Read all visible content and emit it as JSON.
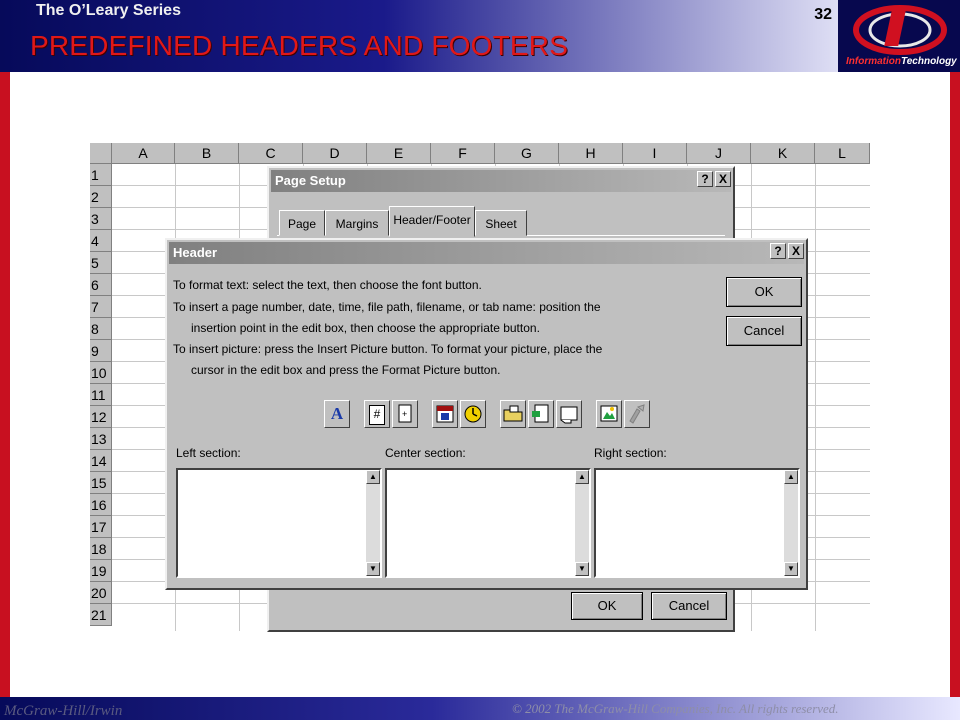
{
  "slide": {
    "series": "The O’Leary Series",
    "title": "PREDEFINED HEADERS AND FOOTERS",
    "page_number": "32",
    "logo_text_a": "Information",
    "logo_text_b": "Technology",
    "publisher": "McGraw-Hill/Irwin",
    "copyright": "© 2002  The McGraw-Hill  Companies, Inc. All rights reserved.",
    "colors": {
      "title": "#e01818",
      "bar": "#060a5a",
      "edge": "#c81020"
    }
  },
  "spreadsheet": {
    "columns": [
      "A",
      "B",
      "C",
      "D",
      "E",
      "F",
      "G",
      "H",
      "I",
      "J",
      "K",
      "L"
    ],
    "rows": [
      "1",
      "2",
      "3",
      "4",
      "5",
      "6",
      "7",
      "8",
      "9",
      "10",
      "11",
      "12",
      "13",
      "14",
      "15",
      "16",
      "17",
      "18",
      "19",
      "20",
      "21"
    ]
  },
  "page_setup": {
    "title": "Page Setup",
    "help": "?",
    "close": "X",
    "tabs": [
      "Page",
      "Margins",
      "Header/Footer",
      "Sheet"
    ],
    "active_tab": "Header/Footer",
    "ok": "OK",
    "cancel": "Cancel"
  },
  "header_dialog": {
    "title": "Header",
    "help": "?",
    "close": "X",
    "instructions": [
      "To format text:  select the text, then choose the font button.",
      "To insert a page number, date, time, file path, filename, or tab name:  position the",
      "insertion point in the edit box, then choose the appropriate button.",
      "To insert picture: press the Insert Picture button.  To format your picture, place the",
      "cursor in the edit box and press the Format Picture button."
    ],
    "ok": "OK",
    "cancel": "Cancel",
    "toolbar_icons": [
      "font-icon",
      "page-number-icon",
      "total-pages-icon",
      "date-icon",
      "time-icon",
      "file-path-icon",
      "filename-icon",
      "tab-name-icon",
      "insert-picture-icon",
      "format-picture-icon"
    ],
    "font_glyph": "A",
    "page_glyph": "#",
    "sections": [
      {
        "label": "Left section:",
        "value": ""
      },
      {
        "label": "Center section:",
        "value": ""
      },
      {
        "label": "Right section:",
        "value": ""
      }
    ]
  }
}
